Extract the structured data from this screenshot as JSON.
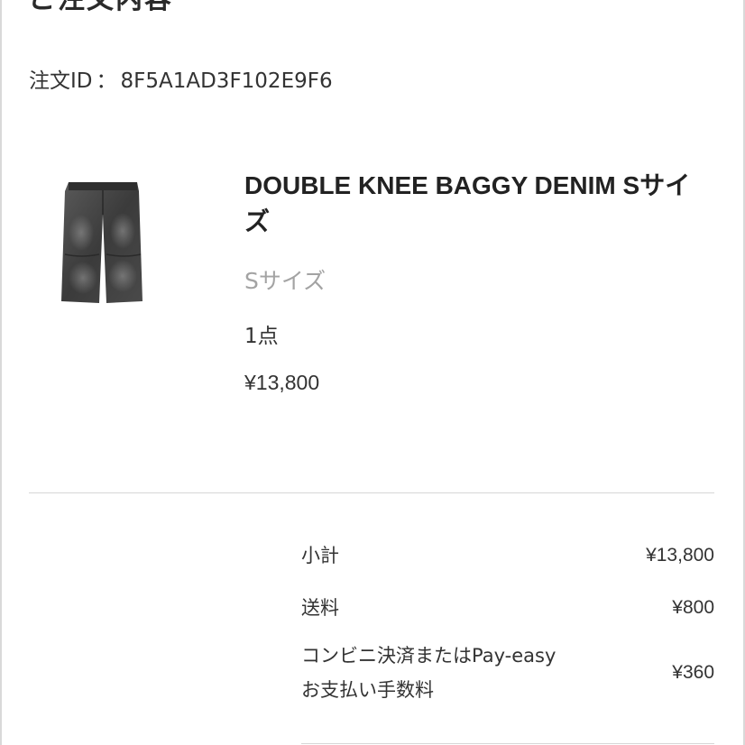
{
  "section": {
    "title": "ご注文内容"
  },
  "order": {
    "label": "注文ID",
    "separator": "：",
    "id": "8F5A1AD3F102E9F6"
  },
  "product": {
    "name": "DOUBLE KNEE BAGGY DENIM Sサイズ",
    "variant": "Sサイズ",
    "quantity": "1点",
    "price": "¥13,800",
    "image_icon": "denim-pants-thumbnail"
  },
  "summary": {
    "rows": [
      {
        "label": "小計",
        "value": "¥13,800"
      },
      {
        "label": "送料",
        "value": "¥800"
      },
      {
        "label_line1": "コンビニ決済またはPay-easy",
        "label_line2": "お支払い手数料",
        "value": "¥360"
      }
    ]
  }
}
